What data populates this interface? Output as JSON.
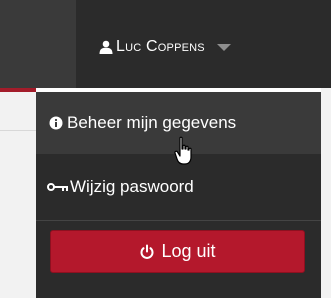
{
  "navbar": {
    "user_name": "Luc Coppens",
    "user_icon": "user-icon",
    "caret_icon": "caret-down-icon"
  },
  "menu": {
    "items": [
      {
        "label": "Beheer mijn gegevens",
        "icon": "info-circle-icon"
      },
      {
        "label": "Wijzig paswoord",
        "icon": "key-icon"
      }
    ],
    "logout": {
      "label": "Log uit",
      "icon": "power-icon"
    }
  },
  "colors": {
    "navbar_bg": "#2b2b2b",
    "menu_hover_bg": "#3a3a3a",
    "logout_red": "#b4182c",
    "caret_gray": "#8e8e8e"
  }
}
